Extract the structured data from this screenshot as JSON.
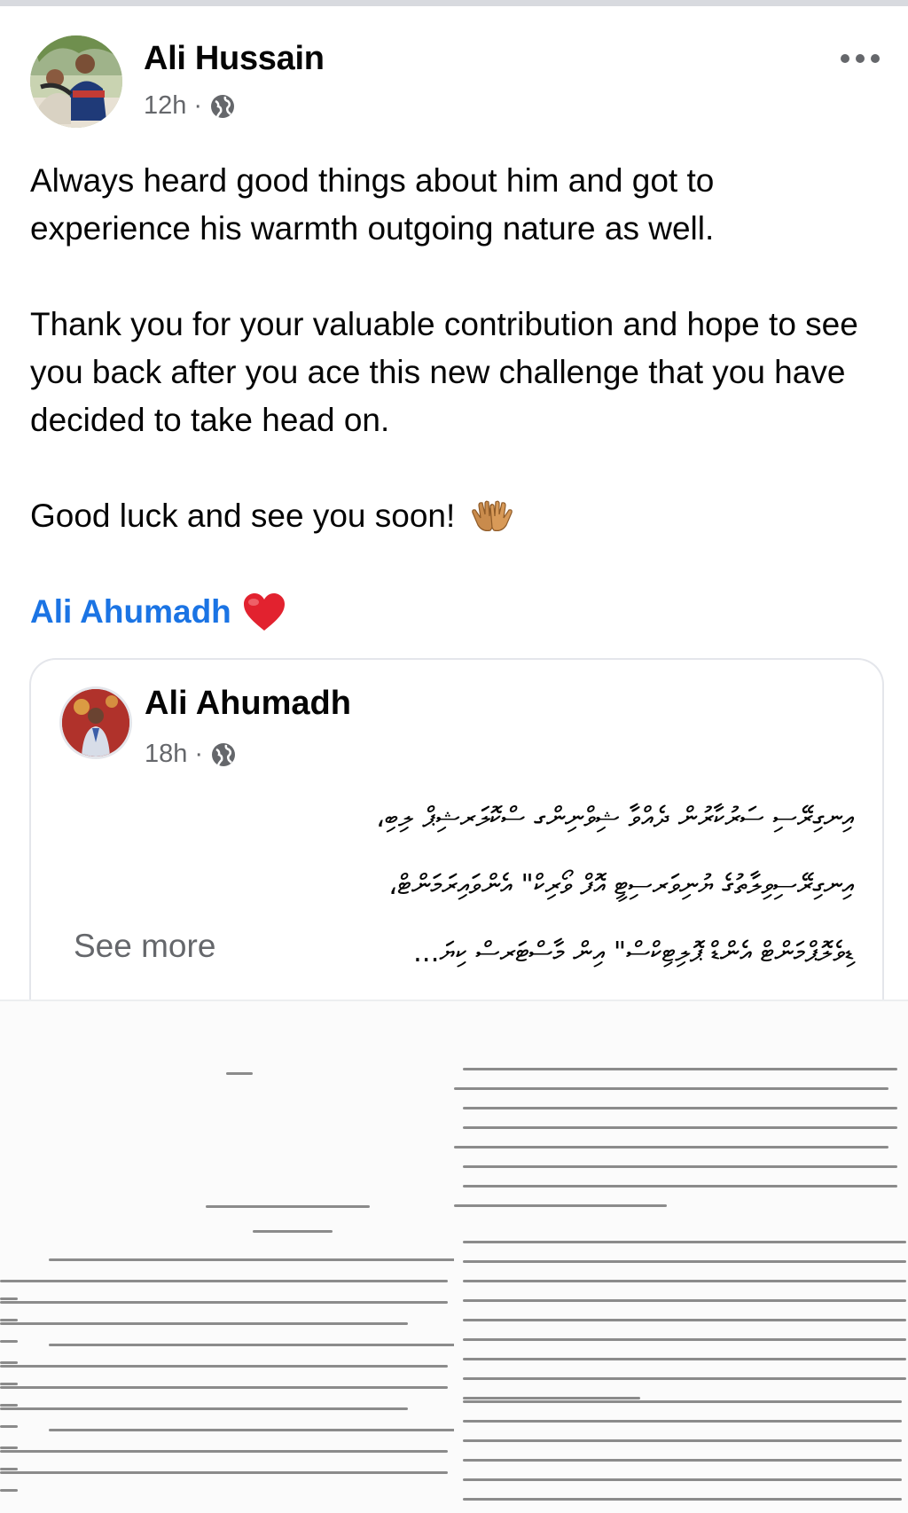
{
  "post": {
    "author": "Ali Hussain",
    "time": "12h",
    "separator": "·",
    "privacy_icon": "globe-icon",
    "more_icon": "more-options-icon",
    "paragraphs": [
      "Always heard good things about him and got to experience his warmth outgoing nature as well.",
      "Thank you for your valuable contribution and hope to see you back after you ace this new challenge that you have decided to take head on.",
      "Good luck and see you soon!"
    ],
    "emoji_icon": "open-hands-icon",
    "mention": "Ali Ahumadh",
    "mention_icon": "red-heart-icon"
  },
  "shared": {
    "author": "Ali Ahumadh",
    "time": "18h",
    "separator": "·",
    "privacy_icon": "globe-icon",
    "lines": [
      "އިނގިރޭސި ސަރުކާރުން ދެއްވާ ޝިވްނިންގ ސްކޮލަރޝިޕް ލިބި،",
      "އިނގިރޭސިވިލާތުގެ ޔުނިވަރސިޓީ އޮފް ވޯރިކް\" އެންވައިރަމަންޓް،",
      "ޑިވެލޮޕްމަންޓް އެންޑް ޕޮލިޓިކްސް\" އިން މާސްޓަރސް ކިޔަ..."
    ],
    "see_more": "See more"
  },
  "colors": {
    "mention": "#1b74e4",
    "secondary_text": "#65676b",
    "heart": "#e2222f"
  }
}
